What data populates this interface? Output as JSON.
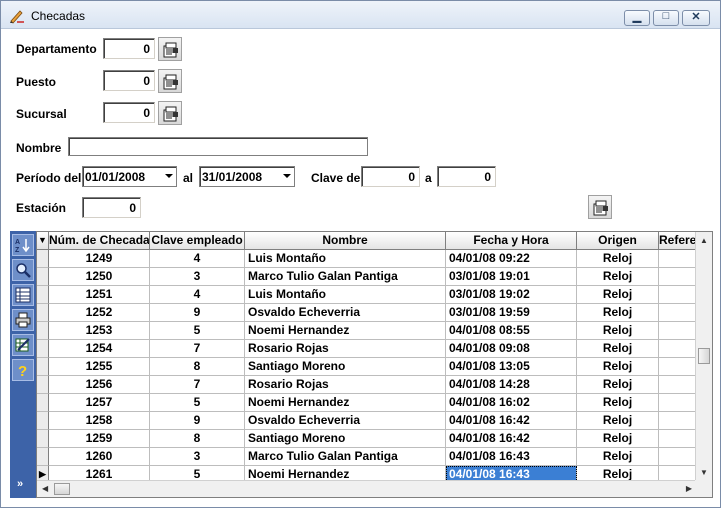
{
  "window": {
    "title": "Checadas"
  },
  "form": {
    "departamento": {
      "label": "Departamento",
      "value": "0"
    },
    "puesto": {
      "label": "Puesto",
      "value": "0"
    },
    "sucursal": {
      "label": "Sucursal",
      "value": "0"
    },
    "nombre": {
      "label": "Nombre",
      "value": ""
    },
    "periodo": {
      "label": "Período del",
      "from": "01/01/2008",
      "to_label": "al",
      "to": "31/01/2008"
    },
    "clave": {
      "label": "Clave de",
      "from": "0",
      "to_label": "a",
      "to": "0"
    },
    "estacion": {
      "label": "Estación",
      "value": "0"
    }
  },
  "grid": {
    "columns": [
      "Núm. de Checada",
      "Clave empleado",
      "Nombre",
      "Fecha y Hora",
      "Origen",
      "Referencia"
    ],
    "rows": [
      {
        "num": "1249",
        "clave": "4",
        "nombre": "Luis Montaño",
        "fecha": "04/01/08 09:22",
        "origen": "Reloj"
      },
      {
        "num": "1250",
        "clave": "3",
        "nombre": "Marco Tulio Galan Pantiga",
        "fecha": "03/01/08 19:01",
        "origen": "Reloj"
      },
      {
        "num": "1251",
        "clave": "4",
        "nombre": "Luis Montaño",
        "fecha": "03/01/08 19:02",
        "origen": "Reloj"
      },
      {
        "num": "1252",
        "clave": "9",
        "nombre": "Osvaldo Echeverria",
        "fecha": "03/01/08 19:59",
        "origen": "Reloj"
      },
      {
        "num": "1253",
        "clave": "5",
        "nombre": "Noemi Hernandez",
        "fecha": "04/01/08 08:55",
        "origen": "Reloj"
      },
      {
        "num": "1254",
        "clave": "7",
        "nombre": "Rosario Rojas",
        "fecha": "04/01/08 09:08",
        "origen": "Reloj"
      },
      {
        "num": "1255",
        "clave": "8",
        "nombre": "Santiago Moreno",
        "fecha": "04/01/08 13:05",
        "origen": "Reloj"
      },
      {
        "num": "1256",
        "clave": "7",
        "nombre": "Rosario Rojas",
        "fecha": "04/01/08 14:28",
        "origen": "Reloj"
      },
      {
        "num": "1257",
        "clave": "5",
        "nombre": "Noemi Hernandez",
        "fecha": "04/01/08 16:02",
        "origen": "Reloj"
      },
      {
        "num": "1258",
        "clave": "9",
        "nombre": "Osvaldo Echeverria",
        "fecha": "04/01/08 16:42",
        "origen": "Reloj"
      },
      {
        "num": "1259",
        "clave": "8",
        "nombre": "Santiago Moreno",
        "fecha": "04/01/08 16:42",
        "origen": "Reloj"
      },
      {
        "num": "1260",
        "clave": "3",
        "nombre": "Marco Tulio Galan Pantiga",
        "fecha": "04/01/08 16:43",
        "origen": "Reloj"
      },
      {
        "num": "1261",
        "clave": "5",
        "nombre": "Noemi Hernandez",
        "fecha": "04/01/08 16:43",
        "origen": "Reloj"
      }
    ],
    "selected_row": 12
  },
  "sidebar": {
    "buttons": [
      "sort-az-icon",
      "search-icon",
      "grid-icon",
      "print-icon",
      "export-icon",
      "help-icon"
    ],
    "more": "»"
  },
  "colors": {
    "sidebar": "#3d63a8",
    "selection": "#3b7fd4"
  }
}
